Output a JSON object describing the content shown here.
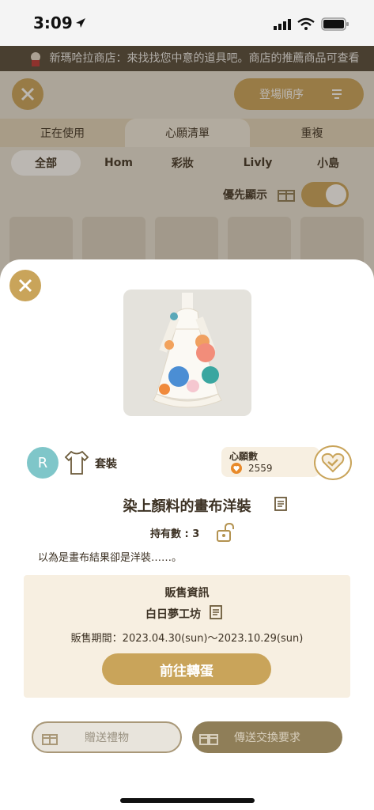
{
  "status_bar": {
    "time": "3:09"
  },
  "background": {
    "ticker": "新瑪哈拉商店：來找找您中意的道具吧。商店的推薦商品可查看",
    "sort_label": "登場順序",
    "tabs": [
      "正在使用",
      "心願清單",
      "重複"
    ],
    "subtabs": [
      "全部",
      "Hom",
      "彩妝",
      "Livly",
      "小島"
    ],
    "priority_label": "優先顯示"
  },
  "item": {
    "rarity": "R",
    "category": "套裝",
    "wish_label": "心願數",
    "wish_count": "2559",
    "name": "染上顏料的畫布洋裝",
    "owned": "持有數 : 3",
    "description": "以為是畫布結果卻是洋裝……。"
  },
  "sale": {
    "title": "販售資訊",
    "shop": "白日夢工坊",
    "period": "販售期間：2023.04.30(sun)〜2023.10.29(sun)",
    "go_button": "前往轉蛋"
  },
  "actions": {
    "gift": "贈送禮物",
    "trade": "傳送交換要求"
  },
  "colors": {
    "gold": "#c9a45a",
    "cream": "#f7efe1",
    "brown": "#3d3224"
  }
}
